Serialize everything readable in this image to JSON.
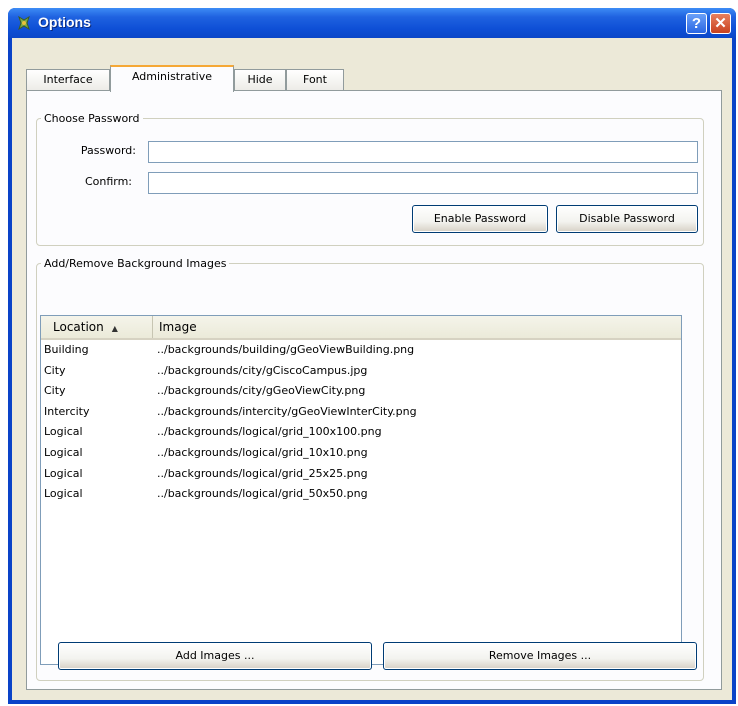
{
  "window": {
    "title": "Options",
    "help_glyph": "?",
    "close_glyph": "✕"
  },
  "tabs": [
    {
      "label": "Interface",
      "active": false
    },
    {
      "label": "Administrative",
      "active": true
    },
    {
      "label": "Hide",
      "active": false
    },
    {
      "label": "Font",
      "active": false
    }
  ],
  "password_group": {
    "legend": "Choose Password",
    "password_label": "Password:",
    "password_value": "",
    "confirm_label": "Confirm:",
    "confirm_value": "",
    "enable_button": "Enable Password",
    "disable_button": "Disable Password"
  },
  "images_group": {
    "legend": "Add/Remove Background Images",
    "columns": [
      "Location",
      "Image"
    ],
    "sort_indicator": "▲",
    "rows": [
      {
        "location": "Building",
        "image": "../backgrounds/building/gGeoViewBuilding.png"
      },
      {
        "location": "City",
        "image": "../backgrounds/city/gCiscoCampus.jpg"
      },
      {
        "location": "City",
        "image": "../backgrounds/city/gGeoViewCity.png"
      },
      {
        "location": "Intercity",
        "image": "../backgrounds/intercity/gGeoViewInterCity.png"
      },
      {
        "location": "Logical",
        "image": "../backgrounds/logical/grid_100x100.png"
      },
      {
        "location": "Logical",
        "image": "../backgrounds/logical/grid_10x10.png"
      },
      {
        "location": "Logical",
        "image": "../backgrounds/logical/grid_25x25.png"
      },
      {
        "location": "Logical",
        "image": "../backgrounds/logical/grid_50x50.png"
      }
    ],
    "add_button": "Add Images ...",
    "remove_button": "Remove Images ..."
  },
  "colors": {
    "titlebar": "#0a43c8",
    "dialog_bg": "#ece9d8",
    "active_tab_accent": "#f5a836"
  }
}
